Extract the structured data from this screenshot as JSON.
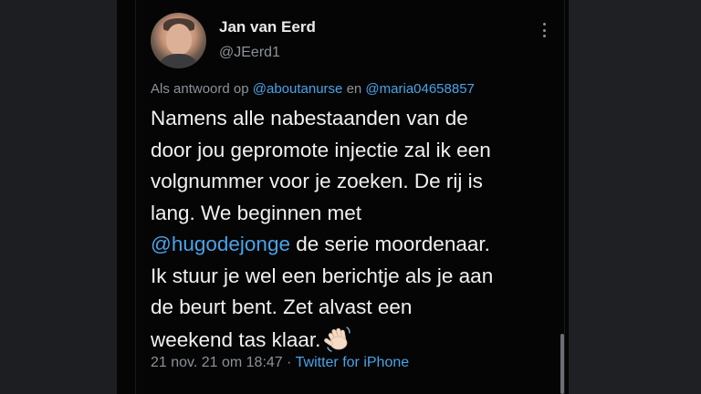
{
  "tweet": {
    "display_name": "Jan van Eerd",
    "handle": "@JEerd1",
    "reply": {
      "prefix": "Als antwoord op",
      "mention1": "@aboutanurse",
      "conjunction": "en",
      "mention2": "@maria04658857"
    },
    "lines": [
      "Namens alle nabestaanden van de",
      "door jou gepromote injectie zal ik een",
      "volgnummer voor je zoeken. De rij is",
      "lang. We beginnen met"
    ],
    "mention_line": {
      "mention": "@hugodejonge",
      "rest": " de serie moordenaar."
    },
    "lines_after": [
      "Ik stuur je wel een berichtje als je aan",
      "de beurt bent. Zet alvast een"
    ],
    "last_line": "weekend tas klaar.",
    "emoji_icon": "waving-hand-icon",
    "timestamp": "21 nov. 21 om 18:47",
    "separator": "·",
    "source": "Twitter for iPhone"
  },
  "colors": {
    "background": "#050505",
    "text": "#f1f1f1",
    "muted": "#8b9298",
    "link": "#4aa3e8"
  }
}
